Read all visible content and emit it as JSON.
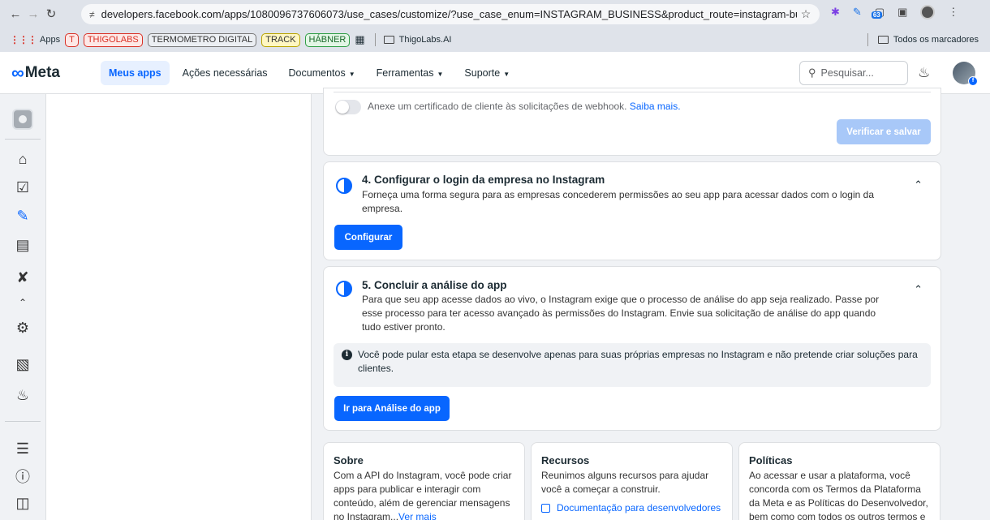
{
  "browser": {
    "url": "developers.facebook.com/apps/1080096737606073/use_cases/customize/?use_case_enum=INSTAGRAM_BUSINESS&product_route=instagram-bu...",
    "ext_badge": "63",
    "bookmarks": {
      "apps": "Apps",
      "t": "T",
      "thigolabs": "THIGOLABS",
      "termometro": "TERMOMETRO DIGITAL",
      "track": "TRACK",
      "habner": "HÁBNER",
      "thigolabs_ai": "ThigoLabs.AI",
      "all_bookmarks": "Todos os marcadores"
    }
  },
  "meta_nav": {
    "logo": "Meta",
    "items": [
      "Meus apps",
      "Ações necessárias",
      "Documentos",
      "Ferramentas",
      "Suporte"
    ],
    "search_placeholder": "Pesquisar..."
  },
  "webhook": {
    "toggle_label": "Anexe um certificado de cliente às solicitações de webhook.",
    "toggle_link": "Saiba mais.",
    "verify_button": "Verificar e salvar"
  },
  "step4": {
    "title": "4. Configurar o login da empresa no Instagram",
    "description": "Forneça uma forma segura para as empresas concederem permissões ao seu app para acessar dados com o login da empresa.",
    "button": "Configurar"
  },
  "step5": {
    "title": "5. Concluir a análise do app",
    "description": "Para que seu app acesse dados ao vivo, o Instagram exige que o processo de análise do app seja realizado. Passe por esse processo para ter acesso avançado às permissões do Instagram. Envie sua solicitação de análise do app quando tudo estiver pronto.",
    "notice": "Você pode pular esta etapa se desenvolve apenas para suas próprias empresas no Instagram e não pretende criar soluções para clientes.",
    "button": "Ir para Análise do app"
  },
  "footer": {
    "sobre": {
      "title": "Sobre",
      "text": "Com a API do Instagram, você pode criar apps para publicar e interagir com conteúdo, além de gerenciar mensagens no Instagram...",
      "link": "Ver mais"
    },
    "recursos": {
      "title": "Recursos",
      "text": "Reunimos alguns recursos para ajudar você a começar a construir.",
      "link": "Documentação para desenvolvedores"
    },
    "politicas": {
      "title": "Políticas",
      "text": "Ao acessar e usar a plataforma, você concorda com os Termos da Plataforma da Meta e as Políticas do Desenvolvedor, bem como com todos os outros termos e"
    }
  },
  "colors": {
    "accent": "#0866ff",
    "accent_disabled": "#a8c8f8",
    "background": "#f0f2f5"
  },
  "icons": {
    "rail": [
      "app-icon",
      "home-icon",
      "checklist-icon",
      "pencil-icon",
      "briefcase-icon",
      "tools-icon",
      "chevron-up-icon",
      "gear-icon",
      "contacts-icon",
      "bell-icon",
      "list-icon",
      "help-icon",
      "panel-toggle-icon"
    ]
  }
}
